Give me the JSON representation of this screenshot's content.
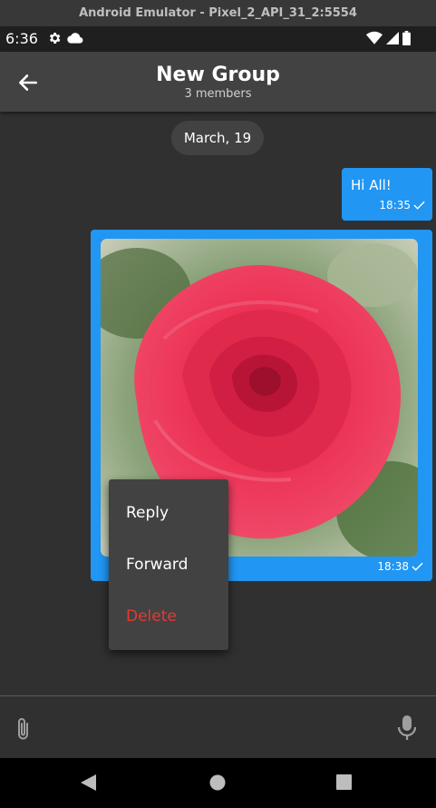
{
  "window": {
    "title": "Android Emulator - Pixel_2_API_31_2:5554"
  },
  "status_bar": {
    "time": "6:36",
    "icons_left": [
      "gear-icon",
      "cloud-icon"
    ],
    "icons_right": [
      "wifi-icon",
      "signal-icon",
      "battery-icon"
    ]
  },
  "app_bar": {
    "title": "New Group",
    "subtitle": "3 members",
    "back_icon": "arrow-back-icon"
  },
  "chat": {
    "date_chip": "March, 19",
    "messages": [
      {
        "type": "text",
        "text": "Hi All!",
        "time": "18:35",
        "status": "check-icon"
      },
      {
        "type": "image",
        "image": "red rose photo",
        "time": "18:38",
        "status": "check-icon"
      }
    ]
  },
  "context_menu": {
    "items": [
      "Reply",
      "Forward",
      "Delete"
    ]
  },
  "input_bar": {
    "attach_icon": "paperclip-icon",
    "mic_icon": "microphone-icon"
  },
  "nav_bar": {
    "buttons": [
      "back-triangle-icon",
      "home-circle-icon",
      "recents-square-icon"
    ]
  },
  "colors": {
    "accent": "#2196f3",
    "background": "#303030",
    "app_bar": "#424242",
    "delete": "#e53935"
  }
}
